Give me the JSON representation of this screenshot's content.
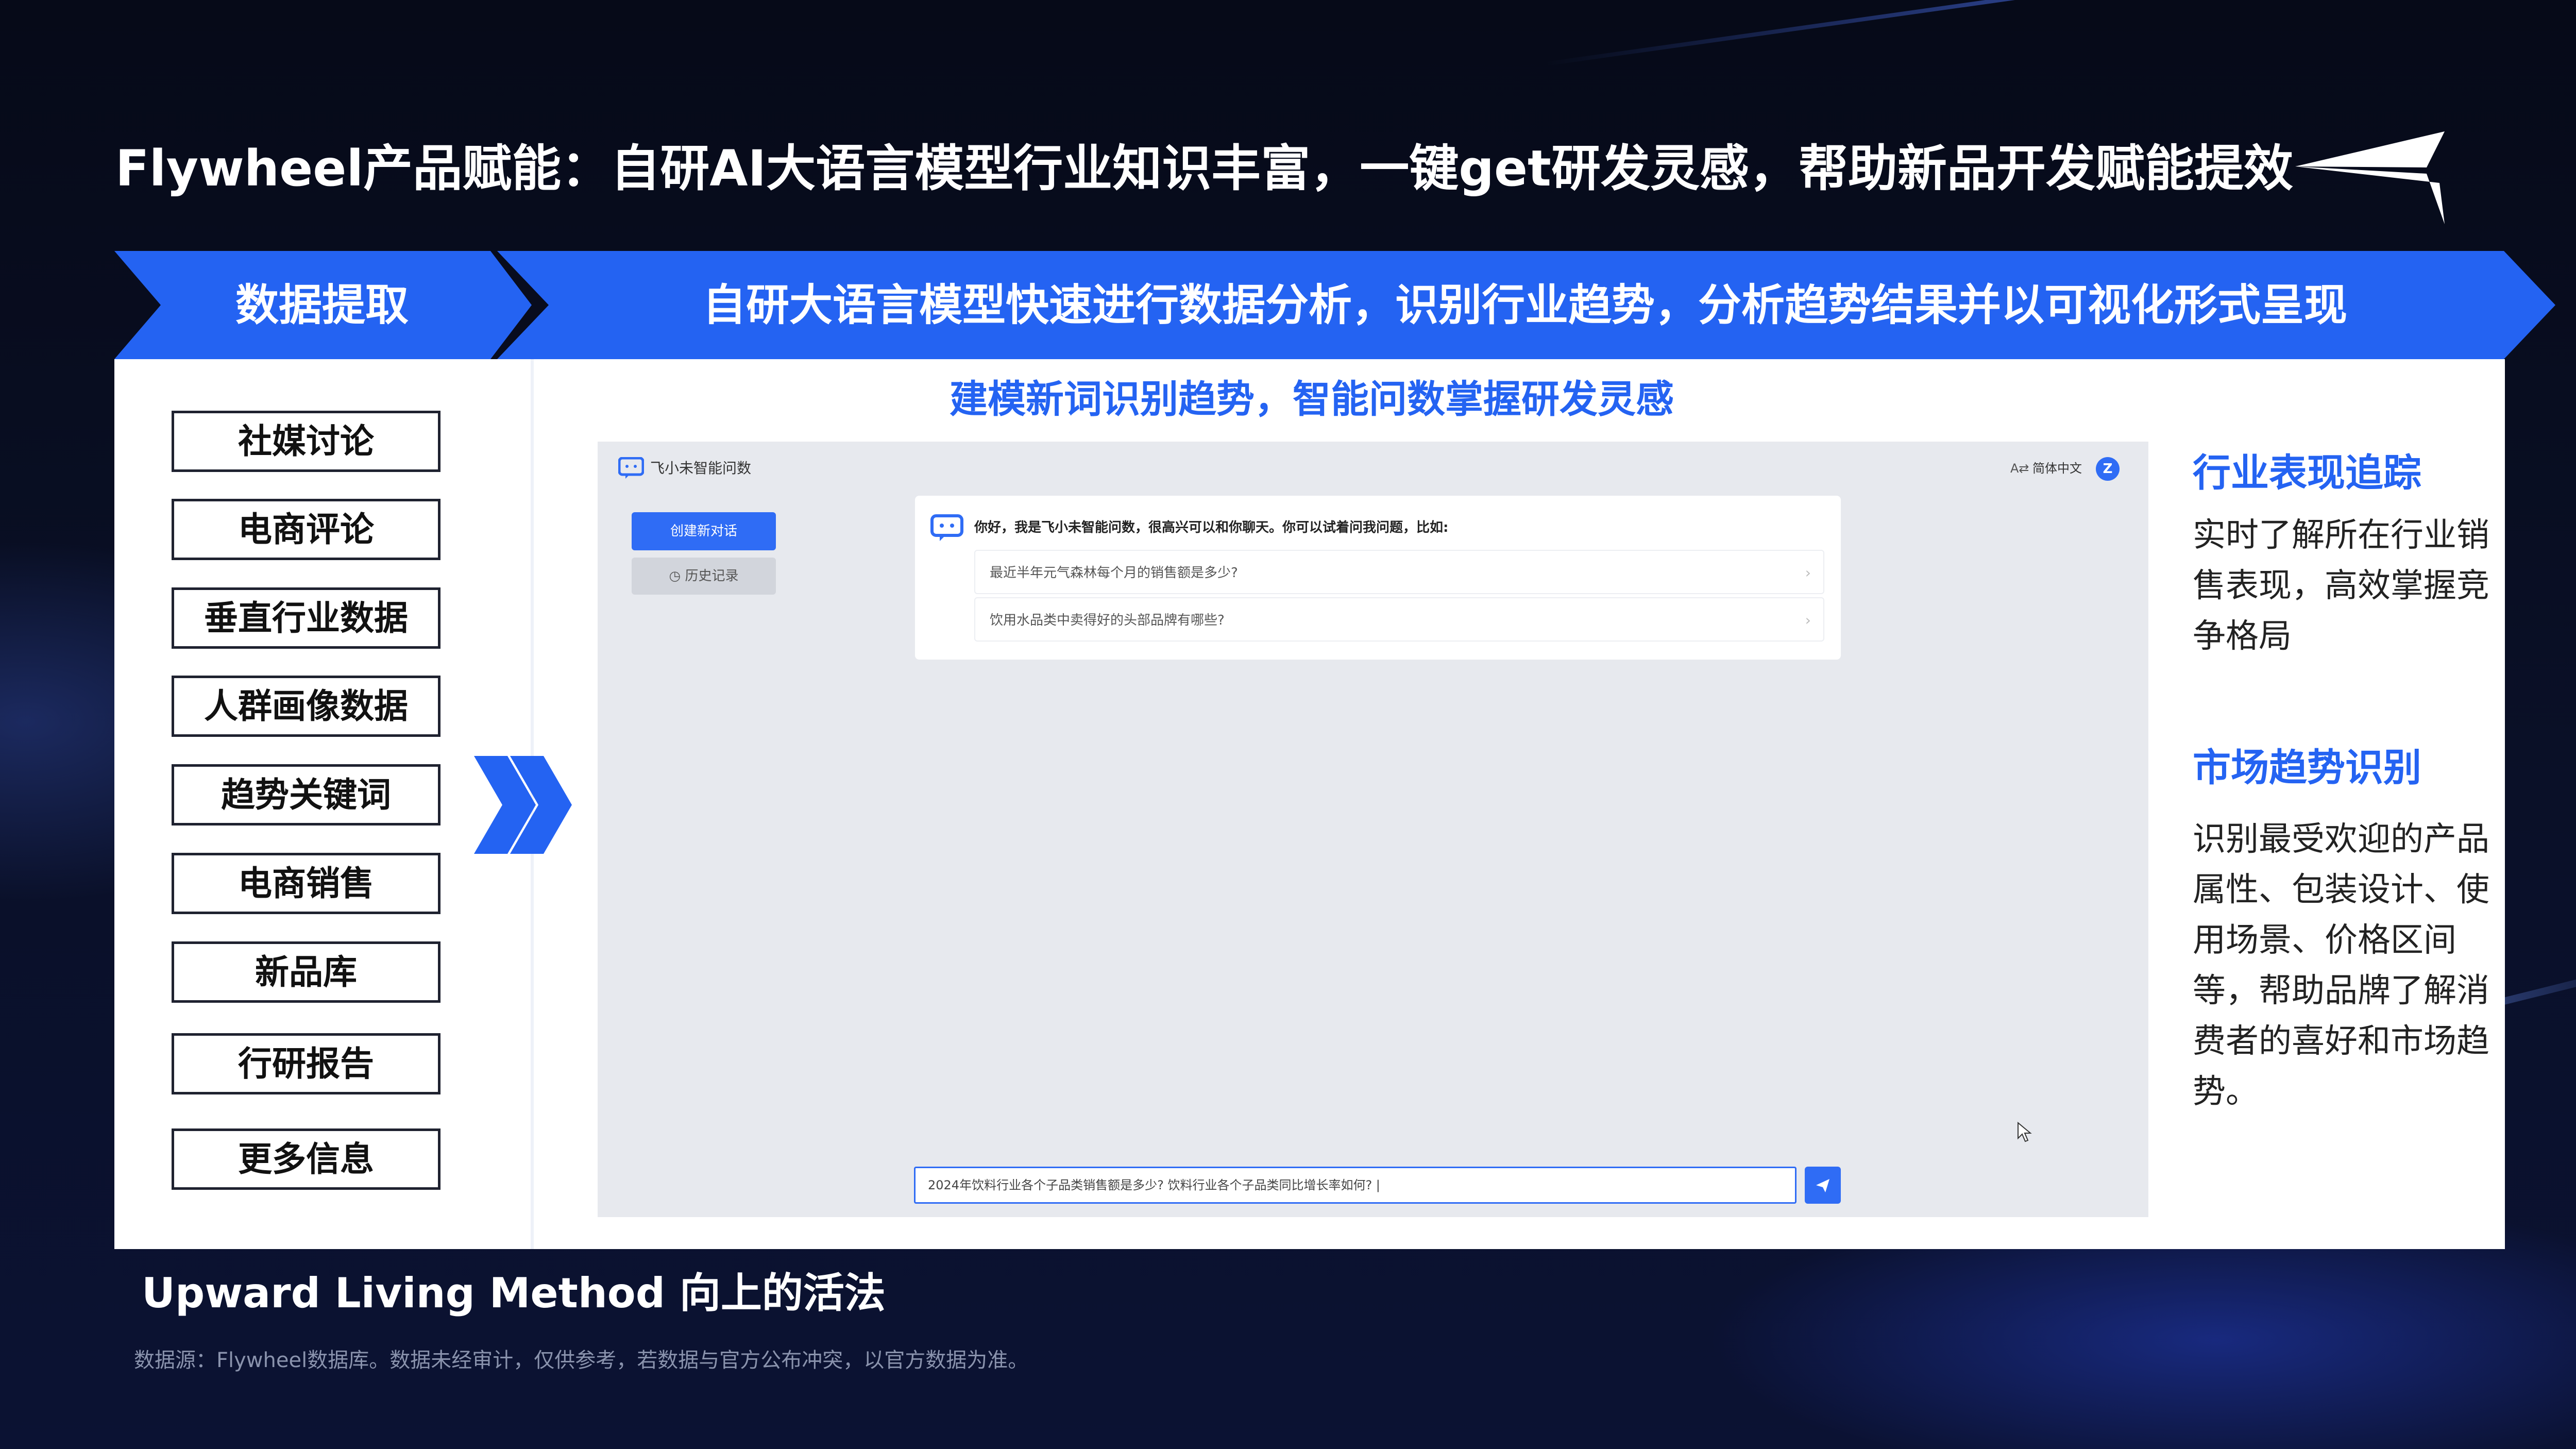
{
  "slide": {
    "title": "Flywheel产品赋能：自研AI大语言模型行业知识丰富，一键get研发灵感，帮助新品开发赋能提效",
    "banner_left": "数据提取",
    "banner_right": "自研大语言模型快速进行数据分析，识别行业趋势，分析趋势结果并以可视化形式呈现",
    "subtitle": "建模新词识别趋势，智能问数掌握研发灵感",
    "sources": [
      "社媒讨论",
      "电商评论",
      "垂直行业数据",
      "人群画像数据",
      "趋势关键词",
      "电商销售",
      "新品库",
      "行研报告",
      "更多信息"
    ],
    "brand": "Upward Living Method  向上的活法",
    "footnote": "数据源：Flywheel数据库。数据未经审计，仅供参考，若数据与官方公布冲突，以官方数据为准。"
  },
  "app": {
    "name": "飞小未智能问数",
    "language": "简体中文",
    "avatar_letter": "Z",
    "new_chat": "创建新对话",
    "history": "历史记录",
    "greeting": "你好，我是飞小未智能问数，很高兴可以和你聊天。你可以试着问我问题，比如:",
    "suggestions": [
      "最近半年元气森林每个月的销售额是多少?",
      "饮用水品类中卖得好的头部品牌有哪些?"
    ],
    "input_value": "2024年饮料行业各个子品类销售额是多少? 饮料行业各个子品类同比增长率如何? |"
  },
  "side": {
    "tracking_title": "行业表现追踪",
    "tracking_body": "实时了解所在行业销售表现，高效掌握竞争格局",
    "trend_title": "市场趋势识别",
    "trend_body": "识别最受欢迎的产品属性、包装设计、使用场景、价格区间等，帮助品牌了解消费者的喜好和市场趋势。"
  },
  "colors": {
    "accent": "#2463f2",
    "app_button": "#2f6cf5",
    "background": "#070c1c"
  },
  "icons": [
    "logo-mark-icon",
    "double-chevron-right-icon",
    "chat-bot-icon",
    "history-clock-icon",
    "translate-icon",
    "chevron-right-icon",
    "send-icon",
    "mouse-cursor-icon"
  ]
}
